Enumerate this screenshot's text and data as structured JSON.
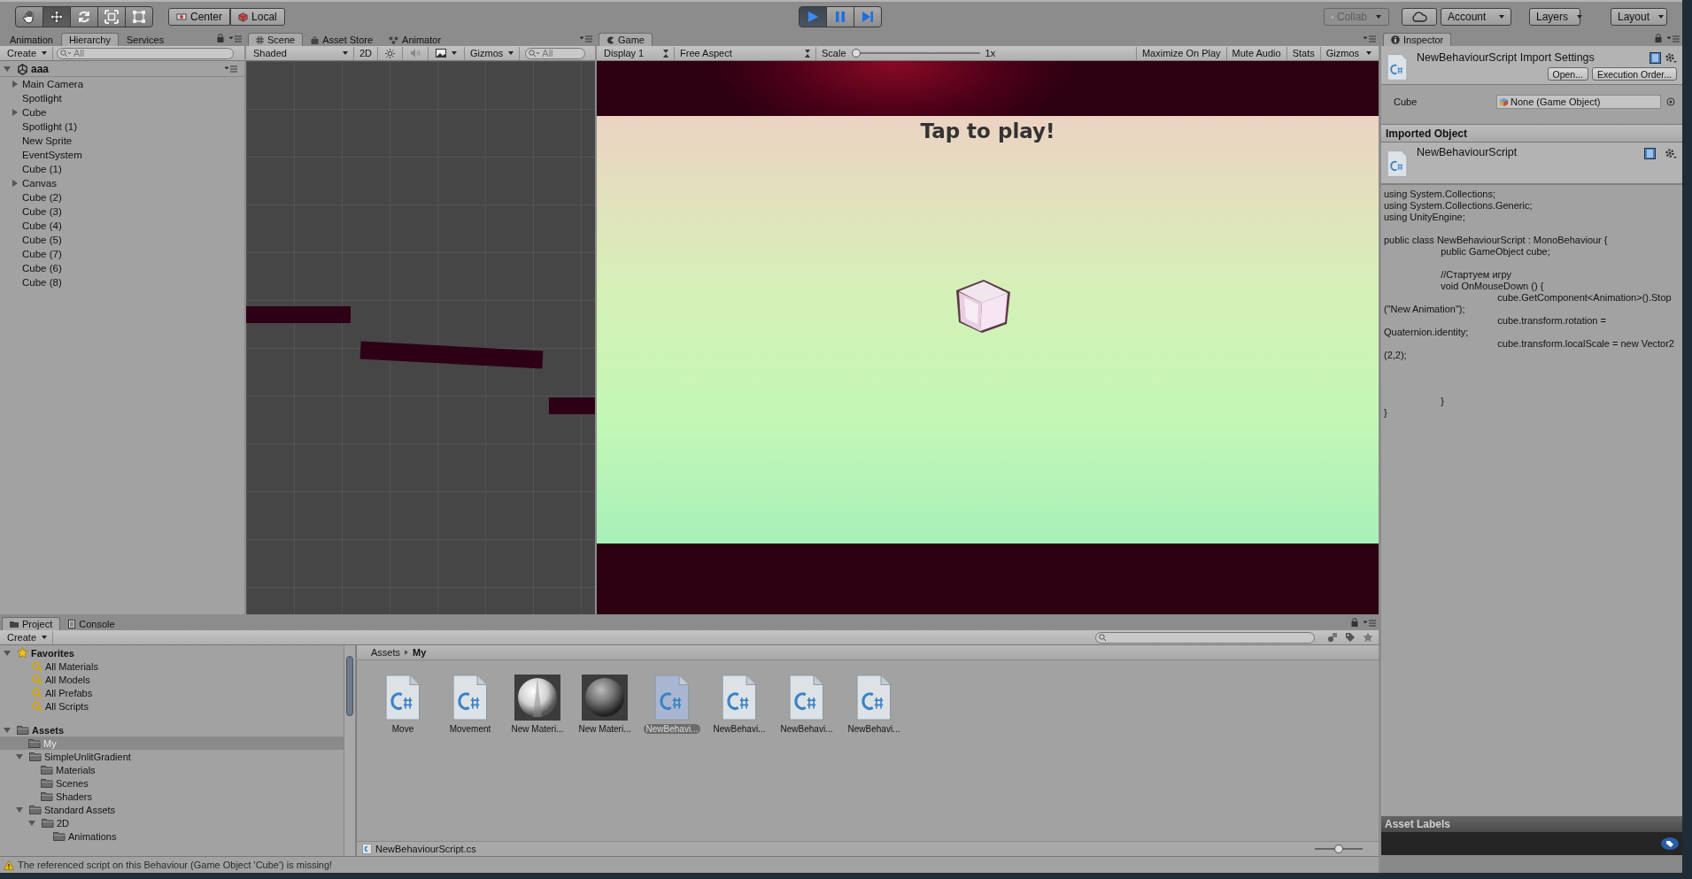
{
  "toolbar": {
    "tools": [
      {
        "kind": "hand",
        "selected": false
      },
      {
        "kind": "move",
        "selected": true
      },
      {
        "kind": "rotate",
        "selected": false
      },
      {
        "kind": "scale",
        "selected": false
      },
      {
        "kind": "rect",
        "selected": false
      }
    ],
    "pivot": [
      {
        "kind": "pivot",
        "label": "Center"
      },
      {
        "kind": "space",
        "label": "Local"
      }
    ],
    "playback": [
      {
        "kind": "play",
        "selected": true
      },
      {
        "kind": "pause",
        "selected": false
      },
      {
        "kind": "step",
        "selected": false
      }
    ],
    "collab": {
      "label": "Collab",
      "disabled": true
    },
    "menus": [
      "Account",
      "Layers",
      "Layout"
    ]
  },
  "hierarchy": {
    "tabs": [
      {
        "label": "Animation",
        "selected": false
      },
      {
        "label": "Hierarchy",
        "selected": true
      },
      {
        "label": "Services",
        "selected": false
      }
    ],
    "create": "Create",
    "search": {
      "placeholder": "All"
    },
    "scene": "aaa",
    "items": [
      {
        "name": "Main Camera",
        "expandable": true,
        "selected": false
      },
      {
        "name": "Spotlight",
        "expandable": false,
        "selected": false
      },
      {
        "name": "Cube",
        "expandable": true,
        "selected": false
      },
      {
        "name": "Spotlight (1)",
        "expandable": false,
        "selected": false
      },
      {
        "name": "New Sprite",
        "expandable": false,
        "selected": false
      },
      {
        "name": "EventSystem",
        "expandable": false,
        "selected": false
      },
      {
        "name": "Cube (1)",
        "expandable": false,
        "selected": false
      },
      {
        "name": "Canvas",
        "expandable": true,
        "selected": false
      },
      {
        "name": "Cube (2)",
        "expandable": false,
        "selected": false
      },
      {
        "name": "Cube (3)",
        "expandable": false,
        "selected": false
      },
      {
        "name": "Cube (4)",
        "expandable": false,
        "selected": false
      },
      {
        "name": "Cube (5)",
        "expandable": false,
        "selected": false
      },
      {
        "name": "Cube (7)",
        "expandable": false,
        "selected": false
      },
      {
        "name": "Cube (6)",
        "expandable": false,
        "selected": false
      },
      {
        "name": "Cube (8)",
        "expandable": false,
        "selected": false
      }
    ]
  },
  "scene_view": {
    "tabs": [
      {
        "label": "Scene",
        "selected": true
      },
      {
        "label": "Asset Store",
        "selected": false
      },
      {
        "label": "Animator",
        "selected": false
      }
    ],
    "shading": "Shaded",
    "mode_2d": "2D",
    "gizmos": "Gizmos",
    "search": {
      "placeholder": "All"
    }
  },
  "game_view": {
    "tab": "Game",
    "display": "Display 1",
    "aspect": "Free Aspect",
    "scale_label": "Scale",
    "scale": {
      "level": 0
    },
    "scale_reading": "1x",
    "buttons": [
      {
        "label": "Maximize On Play",
        "dropdown": false
      },
      {
        "label": "Mute Audio",
        "dropdown": false
      },
      {
        "label": "Stats",
        "dropdown": false
      },
      {
        "label": "Gizmos",
        "dropdown": true
      }
    ],
    "prompt": "Tap to play!"
  },
  "inspector": {
    "tab": "Inspector",
    "title": "NewBehaviourScript Import Settings",
    "buttons": [
      "Open...",
      "Execution Order..."
    ],
    "field": {
      "label": "Cube",
      "value": "None (Game Object)"
    },
    "section": "Imported Object",
    "script_name": "NewBehaviourScript",
    "code": "using System.Collections;\nusing System.Collections.Generic;\nusing UnityEngine;\n\npublic class NewBehaviourScript : MonoBehaviour {\n\tpublic GameObject cube;\n\n\t//Стартуем игру\n\tvoid OnMouseDown () {\n\t\tcube.GetComponent<Animation>().Stop (\"New Animation\");\n\t\tcube.transform.rotation = Quaternion.identity;\n\t\tcube.transform.localScale = new Vector2 (2,2);\n\n\n\n\t}\n}",
    "labels_title": "Asset Labels"
  },
  "project": {
    "tabs": [
      {
        "label": "Project",
        "selected": true
      },
      {
        "label": "Console",
        "selected": false
      }
    ],
    "create": "Create",
    "favorites": {
      "name": "Favorites",
      "expanded": true,
      "selected": false,
      "children": [
        {
          "name": "All Materials",
          "selected": false
        },
        {
          "name": "All Models",
          "selected": false
        },
        {
          "name": "All Prefabs",
          "selected": false
        },
        {
          "name": "All Scripts",
          "selected": false
        }
      ]
    },
    "assets_tree": {
      "name": "Assets",
      "expanded": true,
      "selected": false,
      "children": [
        {
          "name": "My",
          "selected": true
        },
        {
          "name": "SimpleUnlitGradient",
          "expanded": true,
          "selected": false,
          "children": [
            {
              "name": "Materials",
              "selected": false
            },
            {
              "name": "Scenes",
              "selected": false
            },
            {
              "name": "Shaders",
              "selected": false
            }
          ]
        },
        {
          "name": "Standard Assets",
          "expanded": true,
          "selected": false,
          "children": [
            {
              "name": "2D",
              "expanded": true,
              "selected": false,
              "children": [
                {
                  "name": "Animations",
                  "selected": false
                }
              ]
            }
          ]
        }
      ]
    },
    "breadcrumb": [
      "Assets",
      "My"
    ],
    "assets": [
      {
        "kind": "script",
        "name": "Move",
        "selected": false
      },
      {
        "kind": "script",
        "name": "Movement",
        "selected": false
      },
      {
        "kind": "material",
        "name": "New Materi...",
        "selected": false
      },
      {
        "kind": "sphere",
        "name": "New Materi...",
        "selected": false
      },
      {
        "kind": "script",
        "name": "NewBehavi...",
        "selected": true
      },
      {
        "kind": "script",
        "name": "NewBehavi...",
        "selected": false
      },
      {
        "kind": "script",
        "name": "NewBehavi...",
        "selected": false
      },
      {
        "kind": "script",
        "name": "NewBehavi...",
        "selected": false
      }
    ],
    "selected_path": "NewBehaviourScript.cs",
    "icon_size": {
      "level": 0.5
    }
  },
  "status": {
    "message": "The referenced script on this Behaviour (Game Object 'Cube') is missing!"
  }
}
